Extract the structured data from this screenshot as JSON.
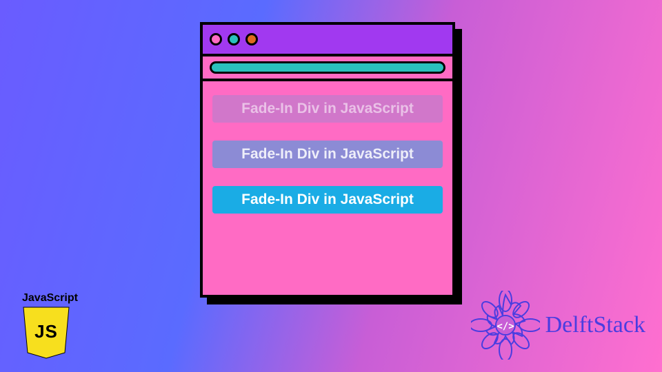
{
  "window": {
    "urlbar_value": "",
    "content": {
      "boxes": [
        {
          "label": "Fade-In Div in JavaScript",
          "opacity": 0.2
        },
        {
          "label": "Fade-In Div in JavaScript",
          "opacity": 0.5
        },
        {
          "label": "Fade-In Div in JavaScript",
          "opacity": 1.0
        }
      ]
    },
    "colors": {
      "titlebar": "#a139f0",
      "body": "#ff6bc4",
      "urlbar": "#2ac0bd",
      "box_bg": "#1aace5",
      "border": "#000000"
    }
  },
  "js_badge": {
    "label": "JavaScript",
    "letters": "JS",
    "shield_color": "#f7df1e"
  },
  "delftstack": {
    "text": "DelftStack",
    "color": "#4a3de0",
    "accent": "#c85ed6"
  }
}
